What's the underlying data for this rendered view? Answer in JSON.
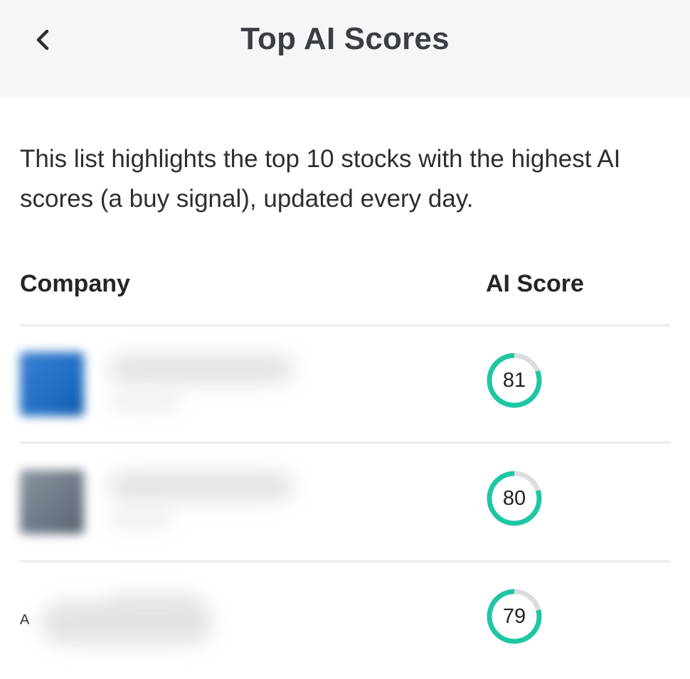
{
  "header": {
    "title": "Top AI Scores",
    "back_icon": "chevron-left-icon"
  },
  "description": "This list highlights the top 10 stocks with the highest AI scores (a buy signal), updated every day.",
  "table": {
    "columns": {
      "company": "Company",
      "ai_score": "AI Score"
    },
    "rows": [
      {
        "logo_color": "#1f6fc4",
        "name_line1": "",
        "name_line2": "",
        "score": "81",
        "score_fraction": 0.81
      },
      {
        "logo_color": "#6c7785",
        "name_line1": "",
        "name_line2": "",
        "score": "80",
        "score_fraction": 0.8
      },
      {
        "logo_letter": "A",
        "name_line1": "",
        "name_line2": "",
        "score": "79",
        "score_fraction": 0.79
      }
    ]
  },
  "colors": {
    "score_ring": "#1ec7a3",
    "score_ring_track": "#dcdcdc",
    "header_bg": "#f5f6f8"
  }
}
